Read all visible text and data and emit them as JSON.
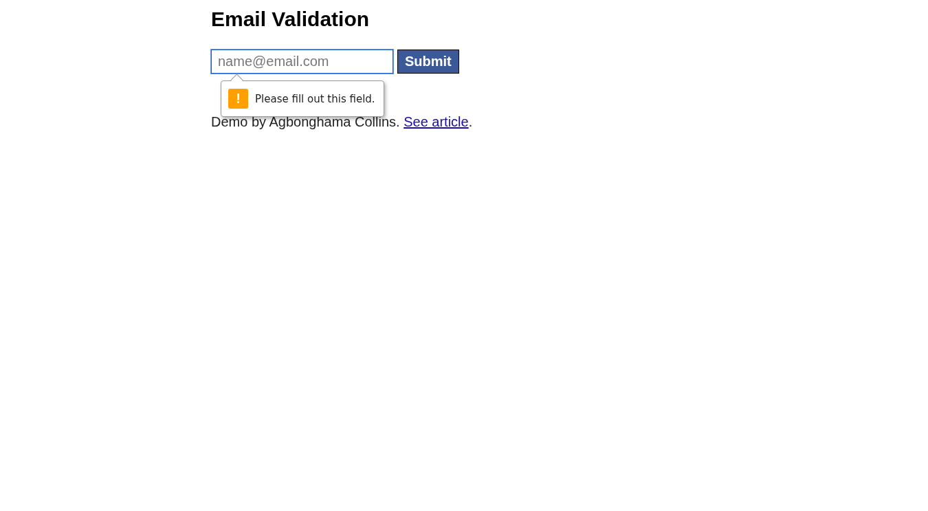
{
  "title": "Email Validation",
  "form": {
    "email": {
      "placeholder": "name@email.com",
      "focused": true
    },
    "submit": "Submit"
  },
  "tooltip": {
    "icon": "!",
    "message": "Please fill out this field."
  },
  "footer": {
    "text": "Demo by Agbonghama Collins.",
    "link": "See article",
    "after": "."
  }
}
